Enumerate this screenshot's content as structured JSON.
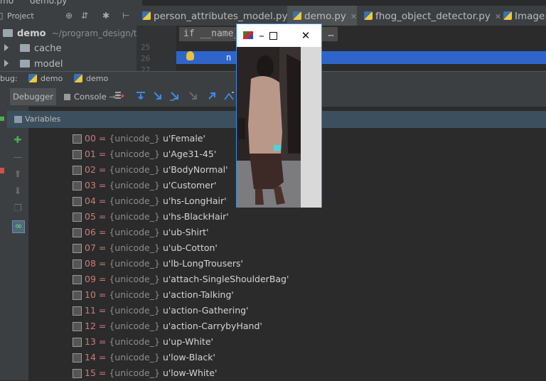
{
  "window": {
    "breadcrumb_fragment": "mo",
    "breadcrumb_file": "demo.py"
  },
  "project_bar": {
    "label": "Project"
  },
  "tabs": [
    {
      "label": "person_attributes_model.py",
      "active": false
    },
    {
      "label": "demo.py",
      "active": true
    },
    {
      "label": "fhog_object_detector.py",
      "active": false
    },
    {
      "label": "Image.",
      "active": false
    }
  ],
  "tree": {
    "root": "demo",
    "root_path": "~/program_design/te",
    "items": [
      {
        "label": "cache"
      },
      {
        "label": "model"
      }
    ]
  },
  "editor": {
    "line_numbers": [
      "25",
      "26",
      "27"
    ],
    "code_hint": "if __name__       t_image …",
    "highlight_text": "n"
  },
  "debug": {
    "header_label": "bug:",
    "sessions": [
      "demo",
      "demo"
    ],
    "tabs": [
      "Debugger",
      "Console"
    ],
    "variables_label": "Variables"
  },
  "variables": [
    {
      "name": "00",
      "type": "{unicode_}",
      "value": "u'Female'"
    },
    {
      "name": "01",
      "type": "{unicode_}",
      "value": "u'Age31-45'"
    },
    {
      "name": "02",
      "type": "{unicode_}",
      "value": "u'BodyNormal'"
    },
    {
      "name": "03",
      "type": "{unicode_}",
      "value": "u'Customer'"
    },
    {
      "name": "04",
      "type": "{unicode_}",
      "value": "u'hs-LongHair'"
    },
    {
      "name": "05",
      "type": "{unicode_}",
      "value": "u'hs-BlackHair'"
    },
    {
      "name": "06",
      "type": "{unicode_}",
      "value": "u'ub-Shirt'"
    },
    {
      "name": "07",
      "type": "{unicode_}",
      "value": "u'ub-Cotton'"
    },
    {
      "name": "08",
      "type": "{unicode_}",
      "value": "u'lb-LongTrousers'"
    },
    {
      "name": "09",
      "type": "{unicode_}",
      "value": "u'attach-SingleShoulderBag'"
    },
    {
      "name": "10",
      "type": "{unicode_}",
      "value": "u'action-Talking'"
    },
    {
      "name": "11",
      "type": "{unicode_}",
      "value": "u'action-Gathering'"
    },
    {
      "name": "12",
      "type": "{unicode_}",
      "value": "u'action-CarrybyHand'"
    },
    {
      "name": "13",
      "type": "{unicode_}",
      "value": "u'up-White'"
    },
    {
      "name": "14",
      "type": "{unicode_}",
      "value": "u'low-Black'"
    },
    {
      "name": "15",
      "type": "{unicode_}",
      "value": "u'low-White'"
    }
  ],
  "colors": {
    "accent": "#2f65ca",
    "var_name": "#cc7a7a",
    "var_type": "#8c8c8c",
    "popup_border": "#3d8ae6"
  },
  "icons": {
    "tree_toggle": "triangle-right",
    "folder": "folder-icon",
    "python_file": "python-icon",
    "variable": "array-element-icon"
  }
}
